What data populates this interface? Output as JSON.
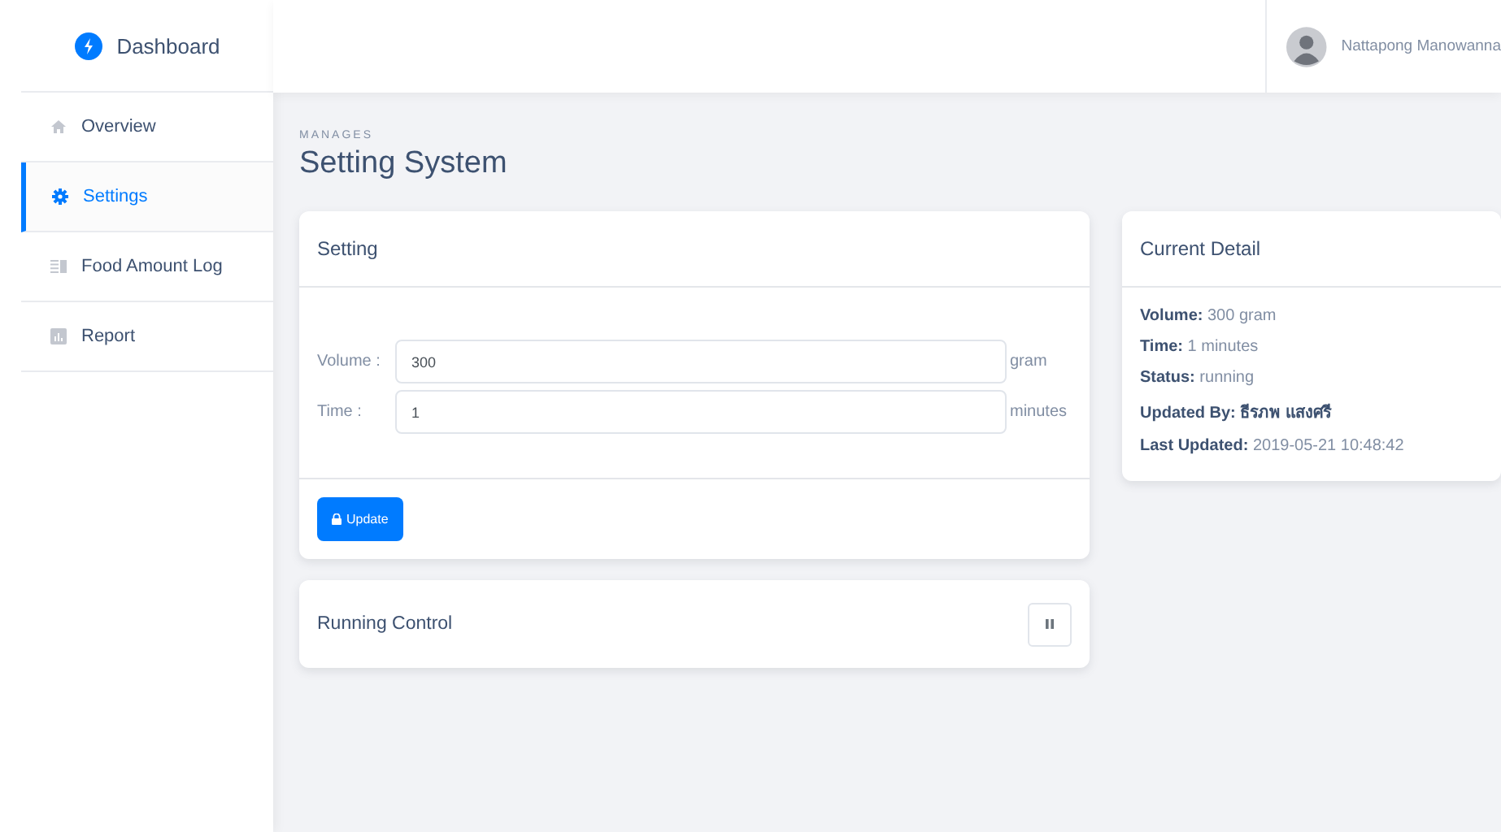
{
  "sidebar": {
    "brand": "Dashboard",
    "items": [
      {
        "label": "Overview",
        "selected": false
      },
      {
        "label": "Settings",
        "selected": true
      },
      {
        "label": "Food Amount Log",
        "selected": false
      },
      {
        "label": "Report",
        "selected": false
      }
    ]
  },
  "header": {
    "user": "Nattapong Manowanna"
  },
  "page": {
    "subtitle": "MANAGES",
    "title": "Setting System"
  },
  "setting_card": {
    "title": "Setting",
    "fields": [
      {
        "label": "Volume :",
        "value": "300",
        "unit": "gram"
      },
      {
        "label": "Time :",
        "value": "1",
        "unit": "minutes"
      }
    ],
    "button": "Update"
  },
  "running_card": {
    "title": "Running Control",
    "running": true
  },
  "detail_card": {
    "title": "Current Detail",
    "lines": [
      "**Volume:** 300 gram",
      "**Time:** 1 minutes",
      "**Status:** running",
      "**Updated By: ธีรภพ แสงศรี**",
      "**Last Updated:** 2019-05-21 10:48:42"
    ]
  }
}
